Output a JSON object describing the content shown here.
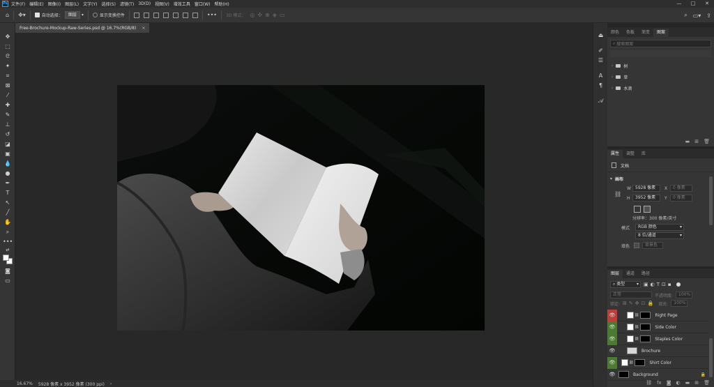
{
  "app": {
    "logo_text": "Ps",
    "menu": [
      "文件(F)",
      "编辑(E)",
      "图像(I)",
      "图层(L)",
      "文字(Y)",
      "选择(S)",
      "滤镜(T)",
      "3D(D)",
      "视图(V)",
      "增效工具",
      "窗口(W)",
      "帮助(H)"
    ],
    "window_controls": [
      "—",
      "□",
      "✕"
    ]
  },
  "options_bar": {
    "auto_select_label": "自动选择：",
    "auto_select_value": "图层",
    "show_transform_label": "显示变换控件",
    "mode_3d_label": "3D 模式："
  },
  "document": {
    "tab_title": "Free-Brochure-Mockup-Raw-Series.psd @ 16.7%(RGB/8)",
    "close_glyph": "×"
  },
  "status_bar": {
    "zoom": "16.67%",
    "doc_info": "5928 像素 x 3952 像素 (300 ppi)",
    "arrow": "›"
  },
  "libraries_panel": {
    "tabs": [
      "颜色",
      "色板",
      "渐变",
      "图案"
    ],
    "active_tab": 3,
    "search_placeholder": "搜索图案",
    "folders": [
      "树",
      "草",
      "水滴"
    ]
  },
  "properties_panel": {
    "tabs": [
      "属性",
      "调整",
      "库"
    ],
    "active_tab": 0,
    "doc_label": "文档",
    "section_canvas": "画布",
    "w_label": "W",
    "w_value": "5928 像素",
    "x_label": "X",
    "x_value": "0 像素",
    "h_label": "H",
    "h_value": "3952 像素",
    "y_label": "Y",
    "y_value": "0 像素",
    "resolution": "分辨率：300 像素/英寸",
    "mode_label": "模式",
    "mode_value": "RGB 颜色",
    "depth_value": "8 位/通道",
    "fill_label": "填色",
    "fill_value": "背景色"
  },
  "layers_panel": {
    "tabs": [
      "图层",
      "通道",
      "路径"
    ],
    "active_tab": 0,
    "filter_kind": "类型",
    "blend_mode": "正常",
    "opacity_label": "不透明度:",
    "opacity_value": "100%",
    "lock_label": "锁定:",
    "fill_label": "填充:",
    "fill_value": "100%",
    "layers": [
      {
        "name": "Right Page",
        "eye_color": "#b8413a",
        "thumb": "white",
        "mask": true
      },
      {
        "name": "Side Color",
        "eye_color": "#4c7a32",
        "thumb": "white",
        "mask": true
      },
      {
        "name": "Staples Color",
        "eye_color": "#4c7a32",
        "thumb": "white",
        "mask": true
      },
      {
        "name": "Brochure",
        "eye_color": "#353535",
        "thumb": "white",
        "mask": false
      },
      {
        "name": "Shirt Color",
        "eye_color": "#4c7a32",
        "thumb": "white",
        "mask": true
      },
      {
        "name": "Background",
        "eye_color": "#353535",
        "thumb": "black",
        "mask": false
      }
    ]
  }
}
